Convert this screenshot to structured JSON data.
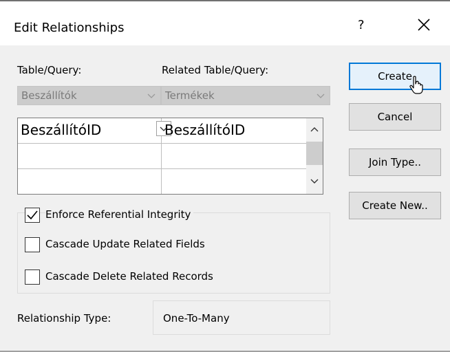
{
  "dialog": {
    "title": "Edit Relationships",
    "help_label": "?",
    "close_icon": "close-icon"
  },
  "labels": {
    "table_query": "Table/Query:",
    "related_table_query": "Related Table/Query:"
  },
  "combos": {
    "table": "Beszállítók",
    "related_table": "Termékek"
  },
  "fields_grid": {
    "rows": [
      {
        "field": "BeszállítóID",
        "related_field": "BeszállítóID"
      },
      {
        "field": "",
        "related_field": ""
      },
      {
        "field": "",
        "related_field": ""
      }
    ]
  },
  "buttons": {
    "create": "Create",
    "cancel": "Cancel",
    "join_type": "Join Type..",
    "create_new": "Create New.."
  },
  "options": {
    "enforce_integrity": {
      "label": "Enforce Referential Integrity",
      "checked": true
    },
    "cascade_update": {
      "label": "Cascade Update Related Fields",
      "checked": false
    },
    "cascade_delete": {
      "label": "Cascade Delete Related Records",
      "checked": false
    }
  },
  "relationship": {
    "label": "Relationship Type:",
    "value": "One-To-Many"
  }
}
